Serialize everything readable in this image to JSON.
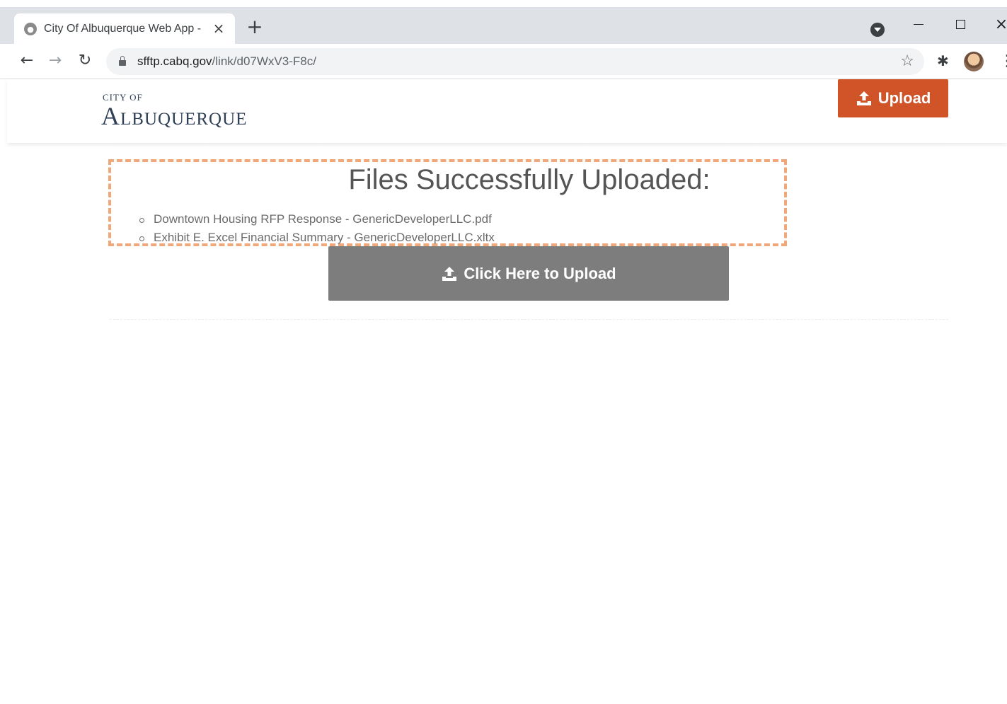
{
  "browser": {
    "tab_title": "City Of Albuquerque Web App -",
    "url_host": "sfftp.cabq.gov",
    "url_path": "/link/d07WxV3-F8c/"
  },
  "header": {
    "logo_small": "CITY OF",
    "logo_large": "Albuquerque",
    "upload_label": "Upload"
  },
  "result": {
    "title": "Files Successfully Uploaded:",
    "files": [
      "Downtown Housing RFP Response - GenericDeveloperLLC.pdf",
      "Exhibit E. Excel Financial Summary - GenericDeveloperLLC.xltx"
    ]
  },
  "main": {
    "upload_label": "Click Here to Upload"
  },
  "colors": {
    "header_upload_bg": "#d15428",
    "main_upload_bg": "#7d7d7d",
    "highlight_border": "#f0a77a",
    "logo_color": "#2f3f55"
  },
  "icons": [
    "upload-icon",
    "lock-icon",
    "star-icon",
    "extensions-icon",
    "close-icon",
    "new-tab-icon",
    "back-icon",
    "forward-icon",
    "reload-icon",
    "menu-icon"
  ]
}
